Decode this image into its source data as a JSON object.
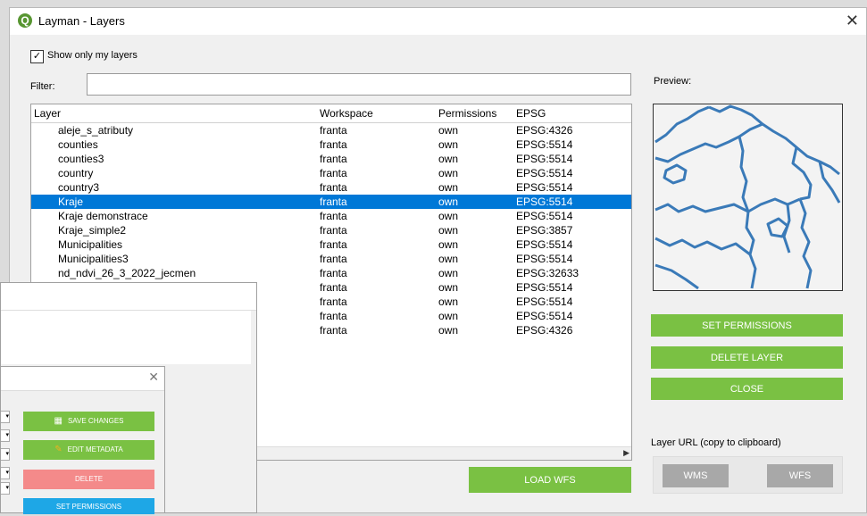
{
  "window": {
    "title": "Layman - Layers",
    "logo_letter": "Q",
    "close_glyph": "✕"
  },
  "show_only_mine": {
    "label": "Show only my layers",
    "checked": true,
    "check_glyph": "✓"
  },
  "filter": {
    "label": "Filter:",
    "value": ""
  },
  "table": {
    "columns": [
      "Layer",
      "Workspace",
      "Permissions",
      "EPSG"
    ],
    "selected_index": 5,
    "rows": [
      {
        "layer": "aleje_s_atributy",
        "workspace": "franta",
        "permissions": "own",
        "epsg": "EPSG:4326"
      },
      {
        "layer": "counties",
        "workspace": "franta",
        "permissions": "own",
        "epsg": "EPSG:5514"
      },
      {
        "layer": "counties3",
        "workspace": "franta",
        "permissions": "own",
        "epsg": "EPSG:5514"
      },
      {
        "layer": "country",
        "workspace": "franta",
        "permissions": "own",
        "epsg": "EPSG:5514"
      },
      {
        "layer": "country3",
        "workspace": "franta",
        "permissions": "own",
        "epsg": "EPSG:5514"
      },
      {
        "layer": "Kraje",
        "workspace": "franta",
        "permissions": "own",
        "epsg": "EPSG:5514"
      },
      {
        "layer": "Kraje demonstrace",
        "workspace": "franta",
        "permissions": "own",
        "epsg": "EPSG:5514"
      },
      {
        "layer": "Kraje_simple2",
        "workspace": "franta",
        "permissions": "own",
        "epsg": "EPSG:3857"
      },
      {
        "layer": "Municipalities",
        "workspace": "franta",
        "permissions": "own",
        "epsg": "EPSG:5514"
      },
      {
        "layer": "Municipalities3",
        "workspace": "franta",
        "permissions": "own",
        "epsg": "EPSG:5514"
      },
      {
        "layer": "nd_ndvi_26_3_2022_jecmen",
        "workspace": "franta",
        "permissions": "own",
        "epsg": "EPSG:32633"
      },
      {
        "layer": "",
        "workspace": "franta",
        "permissions": "own",
        "epsg": "EPSG:5514"
      },
      {
        "layer": "",
        "workspace": "franta",
        "permissions": "own",
        "epsg": "EPSG:5514"
      },
      {
        "layer": "",
        "workspace": "franta",
        "permissions": "own",
        "epsg": "EPSG:5514"
      },
      {
        "layer": "",
        "workspace": "franta",
        "permissions": "own",
        "epsg": "EPSG:4326"
      }
    ],
    "scroll_arrow": "▶"
  },
  "preview": {
    "label": "Preview:"
  },
  "buttons": {
    "set_permissions": "SET PERMISSIONS",
    "delete_layer": "DELETE LAYER",
    "close": "CLOSE",
    "load_wfs": "LOAD WFS"
  },
  "layer_url": {
    "label": "Layer URL (copy to clipboard)",
    "wms": "WMS",
    "wfs": "WFS"
  },
  "sub_dialog": {
    "close_glyph": "✕",
    "save_changes": "SAVE CHANGES",
    "edit_metadata": "EDIT METADATA",
    "delete": "DELETE",
    "set_permissions": "SET PERMISSIONS",
    "combo_arrow": "▾"
  },
  "colors": {
    "accent_green": "#7ac143",
    "selection_blue": "#0078d7",
    "delete_red": "#f48a8a",
    "cyan": "#1ea7e6",
    "map_line": "#3a7ab8"
  }
}
